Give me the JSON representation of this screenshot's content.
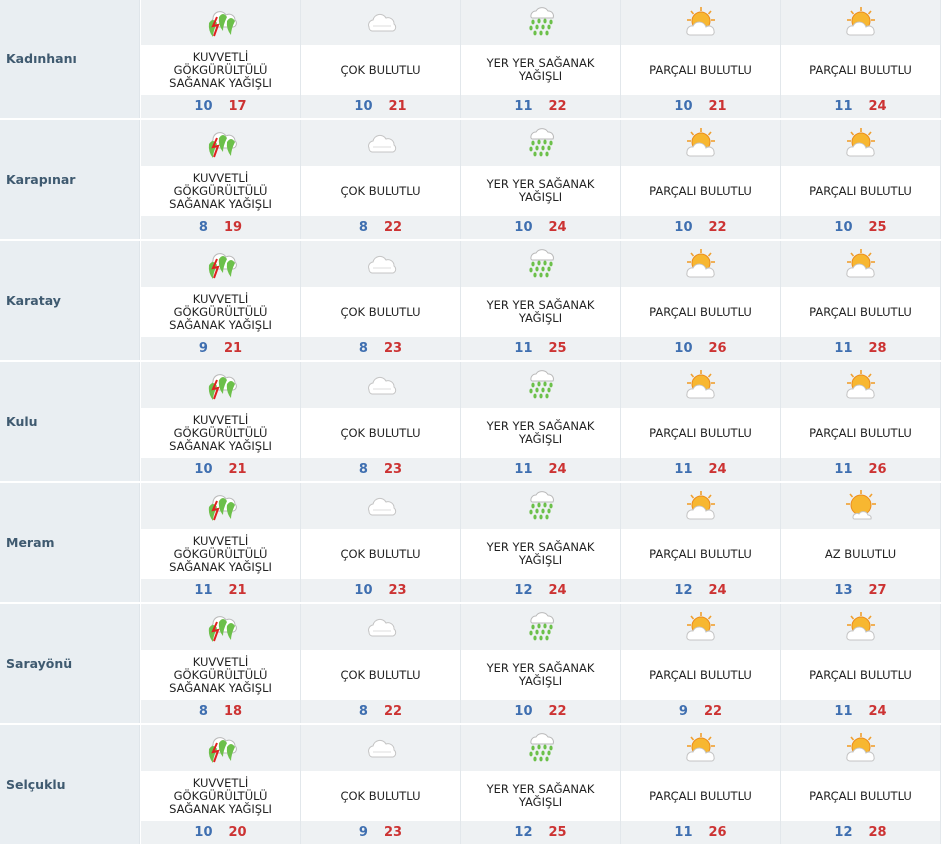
{
  "forecast": {
    "rows": [
      {
        "location": "Kadınhanı",
        "days": [
          {
            "icon": "thunderstorm-icon",
            "desc": "KUVVETLİ GÖKGÜRÜLTÜLÜ SAĞANAK YAĞIŞLI",
            "min": "10",
            "max": "17"
          },
          {
            "icon": "cloud-icon",
            "desc": "ÇOK BULUTLU",
            "min": "10",
            "max": "21"
          },
          {
            "icon": "rain-showers-icon",
            "desc": "YER YER SAĞANAK YAĞIŞLI",
            "min": "11",
            "max": "22"
          },
          {
            "icon": "partly-cloudy-icon",
            "desc": "PARÇALI BULUTLU",
            "min": "10",
            "max": "21"
          },
          {
            "icon": "partly-cloudy-icon",
            "desc": "PARÇALI BULUTLU",
            "min": "11",
            "max": "24"
          }
        ]
      },
      {
        "location": "Karapınar",
        "days": [
          {
            "icon": "thunderstorm-icon",
            "desc": "KUVVETLİ GÖKGÜRÜLTÜLÜ SAĞANAK YAĞIŞLI",
            "min": "8",
            "max": "19"
          },
          {
            "icon": "cloud-icon",
            "desc": "ÇOK BULUTLU",
            "min": "8",
            "max": "22"
          },
          {
            "icon": "rain-showers-icon",
            "desc": "YER YER SAĞANAK YAĞIŞLI",
            "min": "10",
            "max": "24"
          },
          {
            "icon": "partly-cloudy-icon",
            "desc": "PARÇALI BULUTLU",
            "min": "10",
            "max": "22"
          },
          {
            "icon": "partly-cloudy-icon",
            "desc": "PARÇALI BULUTLU",
            "min": "10",
            "max": "25"
          }
        ]
      },
      {
        "location": "Karatay",
        "days": [
          {
            "icon": "thunderstorm-icon",
            "desc": "KUVVETLİ GÖKGÜRÜLTÜLÜ SAĞANAK YAĞIŞLI",
            "min": "9",
            "max": "21"
          },
          {
            "icon": "cloud-icon",
            "desc": "ÇOK BULUTLU",
            "min": "8",
            "max": "23"
          },
          {
            "icon": "rain-showers-icon",
            "desc": "YER YER SAĞANAK YAĞIŞLI",
            "min": "11",
            "max": "25"
          },
          {
            "icon": "partly-cloudy-icon",
            "desc": "PARÇALI BULUTLU",
            "min": "10",
            "max": "26"
          },
          {
            "icon": "partly-cloudy-icon",
            "desc": "PARÇALI BULUTLU",
            "min": "11",
            "max": "28"
          }
        ]
      },
      {
        "location": "Kulu",
        "days": [
          {
            "icon": "thunderstorm-icon",
            "desc": "KUVVETLİ GÖKGÜRÜLTÜLÜ SAĞANAK YAĞIŞLI",
            "min": "10",
            "max": "21"
          },
          {
            "icon": "cloud-icon",
            "desc": "ÇOK BULUTLU",
            "min": "8",
            "max": "23"
          },
          {
            "icon": "rain-showers-icon",
            "desc": "YER YER SAĞANAK YAĞIŞLI",
            "min": "11",
            "max": "24"
          },
          {
            "icon": "partly-cloudy-icon",
            "desc": "PARÇALI BULUTLU",
            "min": "11",
            "max": "24"
          },
          {
            "icon": "partly-cloudy-icon",
            "desc": "PARÇALI BULUTLU",
            "min": "11",
            "max": "26"
          }
        ]
      },
      {
        "location": "Meram",
        "days": [
          {
            "icon": "thunderstorm-icon",
            "desc": "KUVVETLİ GÖKGÜRÜLTÜLÜ SAĞANAK YAĞIŞLI",
            "min": "11",
            "max": "21"
          },
          {
            "icon": "cloud-icon",
            "desc": "ÇOK BULUTLU",
            "min": "10",
            "max": "23"
          },
          {
            "icon": "rain-showers-icon",
            "desc": "YER YER SAĞANAK YAĞIŞLI",
            "min": "12",
            "max": "24"
          },
          {
            "icon": "partly-cloudy-icon",
            "desc": "PARÇALI BULUTLU",
            "min": "12",
            "max": "24"
          },
          {
            "icon": "mostly-sunny-icon",
            "desc": "AZ BULUTLU",
            "min": "13",
            "max": "27"
          }
        ]
      },
      {
        "location": "Sarayönü",
        "days": [
          {
            "icon": "thunderstorm-icon",
            "desc": "KUVVETLİ GÖKGÜRÜLTÜLÜ SAĞANAK YAĞIŞLI",
            "min": "8",
            "max": "18"
          },
          {
            "icon": "cloud-icon",
            "desc": "ÇOK BULUTLU",
            "min": "8",
            "max": "22"
          },
          {
            "icon": "rain-showers-icon",
            "desc": "YER YER SAĞANAK YAĞIŞLI",
            "min": "10",
            "max": "22"
          },
          {
            "icon": "partly-cloudy-icon",
            "desc": "PARÇALI BULUTLU",
            "min": "9",
            "max": "22"
          },
          {
            "icon": "partly-cloudy-icon",
            "desc": "PARÇALI BULUTLU",
            "min": "11",
            "max": "24"
          }
        ]
      },
      {
        "location": "Selçuklu",
        "days": [
          {
            "icon": "thunderstorm-icon",
            "desc": "KUVVETLİ GÖKGÜRÜLTÜLÜ SAĞANAK YAĞIŞLI",
            "min": "10",
            "max": "20"
          },
          {
            "icon": "cloud-icon",
            "desc": "ÇOK BULUTLU",
            "min": "9",
            "max": "23"
          },
          {
            "icon": "rain-showers-icon",
            "desc": "YER YER SAĞANAK YAĞIŞLI",
            "min": "12",
            "max": "25"
          },
          {
            "icon": "partly-cloudy-icon",
            "desc": "PARÇALI BULUTLU",
            "min": "11",
            "max": "26"
          },
          {
            "icon": "partly-cloudy-icon",
            "desc": "PARÇALI BULUTLU",
            "min": "12",
            "max": "28"
          }
        ]
      }
    ]
  },
  "colors": {
    "min_temp": "#3f6fb0",
    "max_temp": "#cc3333",
    "location_text": "#3f5a70",
    "band_bg": "#eef1f3",
    "location_bg": "#e9eef2"
  }
}
